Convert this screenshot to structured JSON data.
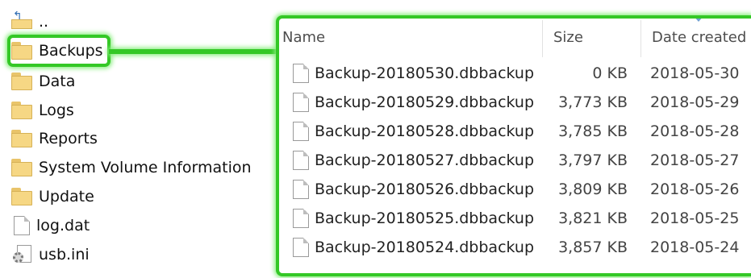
{
  "navigation": {
    "items": [
      {
        "name": "..",
        "type": "up"
      },
      {
        "name": "Backups",
        "type": "folder"
      },
      {
        "name": "Data",
        "type": "folder"
      },
      {
        "name": "Logs",
        "type": "folder"
      },
      {
        "name": "Reports",
        "type": "folder"
      },
      {
        "name": "System Volume Information",
        "type": "folder"
      },
      {
        "name": "Update",
        "type": "folder"
      },
      {
        "name": "log.dat",
        "type": "file"
      },
      {
        "name": "usb.ini",
        "type": "settings-file"
      }
    ]
  },
  "details": {
    "columns": {
      "name": "Name",
      "size": "Size",
      "date_created": "Date created"
    },
    "files": [
      {
        "name": "Backup-20180530.dbbackup",
        "size": "0 KB",
        "date_created": "2018-05-30"
      },
      {
        "name": "Backup-20180529.dbbackup",
        "size": "3,773 KB",
        "date_created": "2018-05-29"
      },
      {
        "name": "Backup-20180528.dbbackup",
        "size": "3,785 KB",
        "date_created": "2018-05-28"
      },
      {
        "name": "Backup-20180527.dbbackup",
        "size": "3,797 KB",
        "date_created": "2018-05-27"
      },
      {
        "name": "Backup-20180526.dbbackup",
        "size": "3,809 KB",
        "date_created": "2018-05-26"
      },
      {
        "name": "Backup-20180525.dbbackup",
        "size": "3,821 KB",
        "date_created": "2018-05-25"
      },
      {
        "name": "Backup-20180524.dbbackup",
        "size": "3,857 KB",
        "date_created": "2018-05-24"
      }
    ]
  },
  "colors": {
    "highlight": "#34c826",
    "folder": "#f6d784",
    "text": "#111111"
  }
}
